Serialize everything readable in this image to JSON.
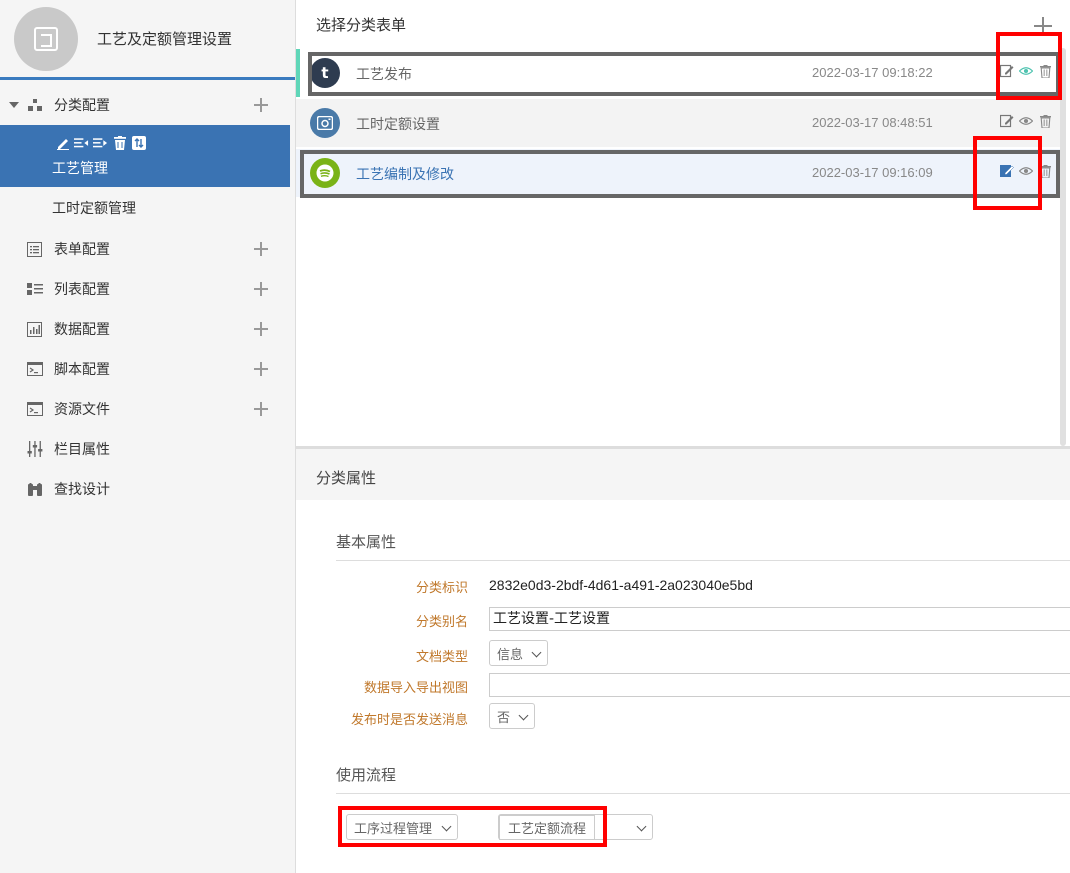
{
  "sidebar": {
    "title": "工艺及定额管理设置",
    "items": [
      {
        "label": "分类配置"
      },
      {
        "label": "工艺管理"
      },
      {
        "label": "工时定额管理"
      },
      {
        "label": "表单配置"
      },
      {
        "label": "列表配置"
      },
      {
        "label": "数据配置"
      },
      {
        "label": "脚本配置"
      },
      {
        "label": "资源文件"
      },
      {
        "label": "栏目属性"
      },
      {
        "label": "查找设计"
      }
    ]
  },
  "list": {
    "title": "选择分类表单",
    "rows": [
      {
        "name": "工艺发布",
        "time": "2022-03-17 09:18:22",
        "avatar": "t",
        "avatar_color": "#2e3c50"
      },
      {
        "name": "工时定额设置",
        "time": "2022-03-17 08:48:51",
        "avatar": "camera-icon",
        "avatar_color": "#4a7aa8"
      },
      {
        "name": "工艺编制及修改",
        "time": "2022-03-17 09:16:09",
        "avatar": "spotify-icon",
        "avatar_color": "#7ab317"
      }
    ]
  },
  "properties": {
    "header": "分类属性",
    "basic_title": "基本属性",
    "fields": {
      "id_label": "分类标识",
      "id_value": "2832e0d3-2bdf-4d61-a491-2a023040e5bd",
      "alias_label": "分类别名",
      "alias_value": "工艺设置-工艺设置",
      "doc_type_label": "文档类型",
      "doc_type_value": "信息",
      "view_label": "数据导入导出视图",
      "view_value": "",
      "notify_label": "发布时是否发送消息",
      "notify_value": "否"
    },
    "flow_title": "使用流程",
    "flow_select_1": "工序过程管理",
    "flow_select_2": "工艺定额流程"
  },
  "colors": {
    "accent": "#3a73b3",
    "label": "#c0782b",
    "highlight_red": "#ff0000",
    "selected_row_bar": "#5fd6b8"
  }
}
